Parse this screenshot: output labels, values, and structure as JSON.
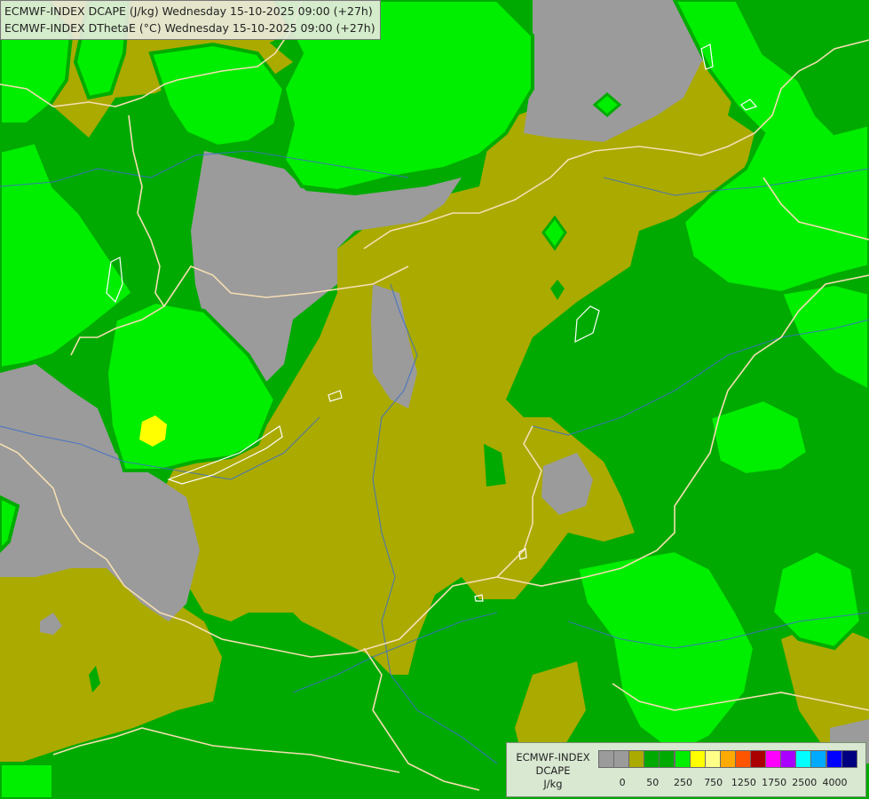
{
  "header": {
    "line1": "ECMWF-INDEX DCAPE (J/kg) Wednesday 15-10-2025 09:00 (+27h)",
    "line2": "ECMWF-INDEX DThetaE (°C) Wednesday 15-10-2025 09:00 (+27h)"
  },
  "colors": {
    "background_olive": "#aaaa00",
    "gray": "#9b9b9b",
    "dark_green": "#00aa00",
    "bright_green": "#00ee00",
    "border_line": "#f5deb3",
    "river_line": "#3e6fc8",
    "yellow": "#ffff00"
  },
  "legend": {
    "title_lines": [
      "ECMWF-INDEX",
      "DCAPE",
      "J/kg"
    ],
    "swatches": [
      {
        "color": "#9b9b9b",
        "name": "gray-swatch"
      },
      {
        "color": "#9b9b9b",
        "name": "gray-swatch"
      },
      {
        "color": "#aaaa00",
        "name": "olive-swatch"
      },
      {
        "color": "#00aa00",
        "name": "dark-green-swatch"
      },
      {
        "color": "#00aa00",
        "name": "dark-green-swatch"
      },
      {
        "color": "#00ee00",
        "name": "bright-green-swatch"
      },
      {
        "color": "#ffff00",
        "name": "yellow-swatch"
      },
      {
        "color": "#ffff88",
        "name": "light-yellow-swatch"
      },
      {
        "color": "#ffaa00",
        "name": "orange-swatch"
      },
      {
        "color": "#ff5500",
        "name": "red-orange-swatch"
      },
      {
        "color": "#aa0000",
        "name": "dark-red-swatch"
      },
      {
        "color": "#ff00ff",
        "name": "magenta-swatch"
      },
      {
        "color": "#aa00ff",
        "name": "purple-swatch"
      },
      {
        "color": "#00ffff",
        "name": "cyan-swatch"
      },
      {
        "color": "#00aaff",
        "name": "light-blue-swatch"
      },
      {
        "color": "#0000ff",
        "name": "blue-swatch"
      },
      {
        "color": "#000080",
        "name": "navy-swatch"
      }
    ],
    "ticks": [
      "0",
      "50",
      "250",
      "750",
      "1250",
      "1750",
      "2500",
      "4000"
    ]
  }
}
